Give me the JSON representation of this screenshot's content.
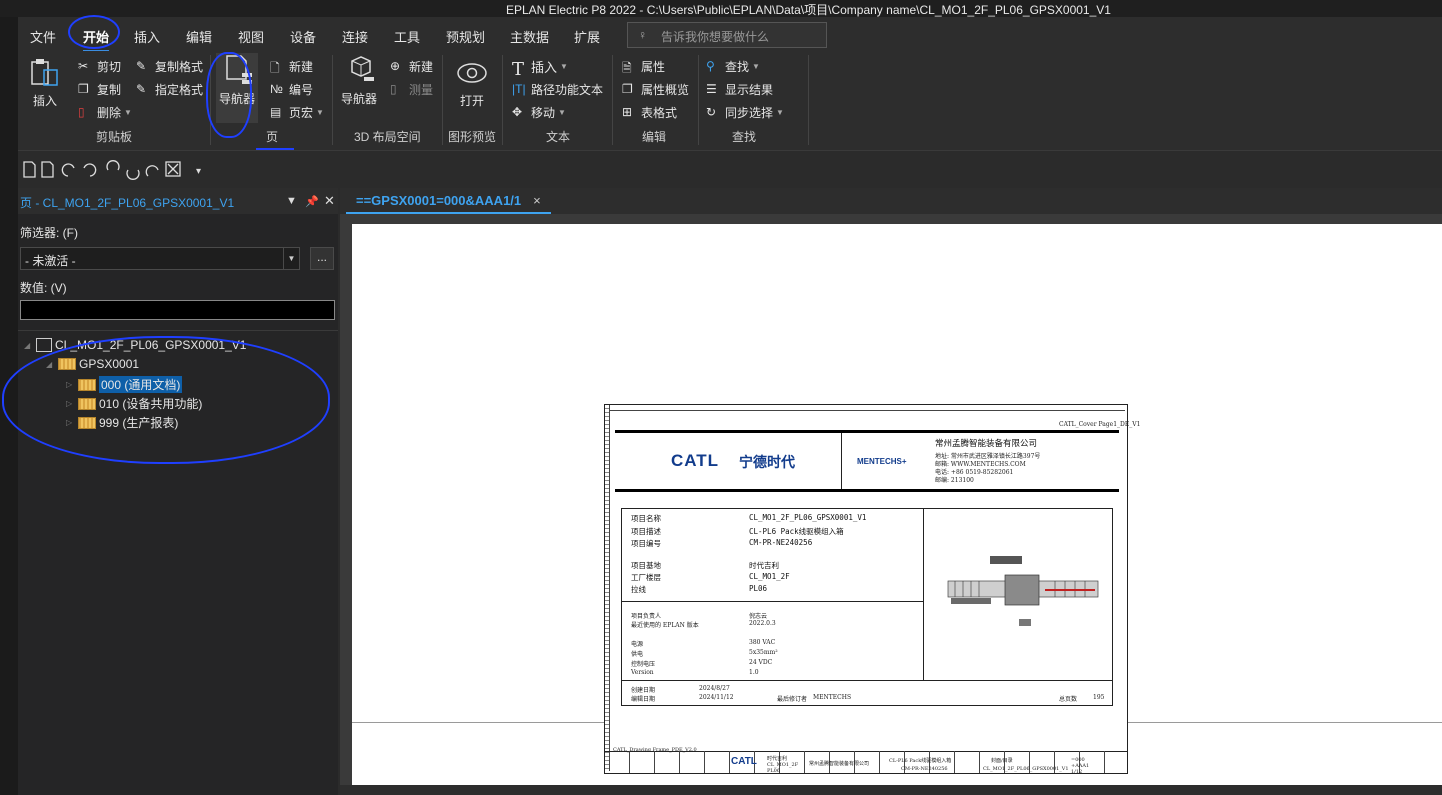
{
  "window": {
    "title": "EPLAN Electric P8 2022 - C:\\Users\\Public\\EPLAN\\Data\\项目\\Company name\\CL_MO1_2F_PL06_GPSX0001_V1"
  },
  "menu": {
    "items": [
      "文件",
      "开始",
      "插入",
      "编辑",
      "视图",
      "设备",
      "连接",
      "工具",
      "预规划",
      "主数据",
      "扩展"
    ],
    "active": "开始",
    "search_placeholder": "告诉我你想要做什么"
  },
  "ribbon": {
    "clipboard": {
      "insert": "插入",
      "cut": "剪切",
      "copy": "复制",
      "delete": "删除",
      "copy_format": "复制格式",
      "apply_format": "指定格式",
      "group": "剪贴板"
    },
    "page": {
      "navigator": "导航器",
      "new": "新建",
      "number": "编号",
      "page_macro": "页宏",
      "group": "页"
    },
    "layout3d": {
      "navigator": "导航器",
      "new": "新建",
      "measure": "测量",
      "group": "3D 布局空间"
    },
    "preview": {
      "open": "打开",
      "group": "图形预览"
    },
    "text": {
      "insert": "插入",
      "path_function_text": "路径功能文本",
      "move": "移动",
      "group": "文本"
    },
    "edit": {
      "properties": "属性",
      "properties_overview": "属性概览",
      "table_format": "表格式",
      "group": "编辑"
    },
    "find": {
      "find": "查找",
      "show_results": "显示结果",
      "sync_select": "同步选择",
      "group": "查找"
    }
  },
  "panel": {
    "title": "页 - CL_MO1_2F_PL06_GPSX0001_V1",
    "filter_label": "筛选器: (F)",
    "filter_value": "- 未激活 -",
    "value_label": "数值: (V)",
    "tree": {
      "project": "CL_MO1_2F_PL06_GPSX0001_V1",
      "station": "GPSX0001",
      "children": [
        "000 (通用文档)",
        "010 (设备共用功能)",
        "999 (生产报表)"
      ]
    }
  },
  "doc_tab": {
    "label": "==GPSX0001=000&AAA1/1",
    "close": "×"
  },
  "sheet": {
    "header_ref": "CATL_Cover Page1_DE_V1",
    "brand_left": "CATL",
    "brand_cn": "宁德时代",
    "brand_right": "MENTECHS+",
    "company_name": "常州孟腾智能装备有限公司",
    "address_lines": [
      "地址:  常州市武进区雅泽镇长江路397号",
      "邮箱:  WWW.MENTECHS.COM",
      "电话:  +86 0519-85282061",
      "邮编:  213100"
    ],
    "fields": [
      {
        "label": "项目名称",
        "value": "CL_MO1_2F_PL06_GPSX0001_V1"
      },
      {
        "label": "项目描述",
        "value": "CL-PL6 Pack线驱模组入箱"
      },
      {
        "label": "项目编号",
        "value": "CM-PR-NE240256"
      },
      {
        "label": "项目基地",
        "value": "时代吉利"
      },
      {
        "label": "工厂楼层",
        "value": "CL_MO1_2F"
      },
      {
        "label": "拉线",
        "value": "PL06"
      }
    ],
    "specs": [
      {
        "label": "项目负责人",
        "value": "倪志云"
      },
      {
        "label": "最近使用的 EPLAN 版本",
        "value": "2022.0.3"
      },
      {
        "label": "电源",
        "value": "380 VAC"
      },
      {
        "label": "供电",
        "value": "5x35mm²"
      },
      {
        "label": "控制电压",
        "value": "24 VDC"
      },
      {
        "label": "Version",
        "value": "1.0"
      }
    ],
    "dates": {
      "created_label": "创建日期",
      "created": "2024/8/27",
      "edited_label": "编辑日期",
      "edited": "2024/11/12",
      "last_editor_label": "最后修订者",
      "last_editor": "MENTECHS",
      "total_pages_label": "总页数",
      "total_pages": "195"
    },
    "footer_ref": "CATL_Drawing Frame_PDE_V2.0",
    "footer_fields": [
      "时代吉利",
      "CL_MO1_2F",
      "PL06",
      "常州孟腾智能装备有限公司",
      "CL-PL6 Pack线驱模组入箱",
      "CM-PR-NE240256",
      "封面/目录",
      "CL_MO1_2F_PL06_GPSX0001_V1",
      "=000",
      "+AAA1",
      "1/12"
    ]
  }
}
